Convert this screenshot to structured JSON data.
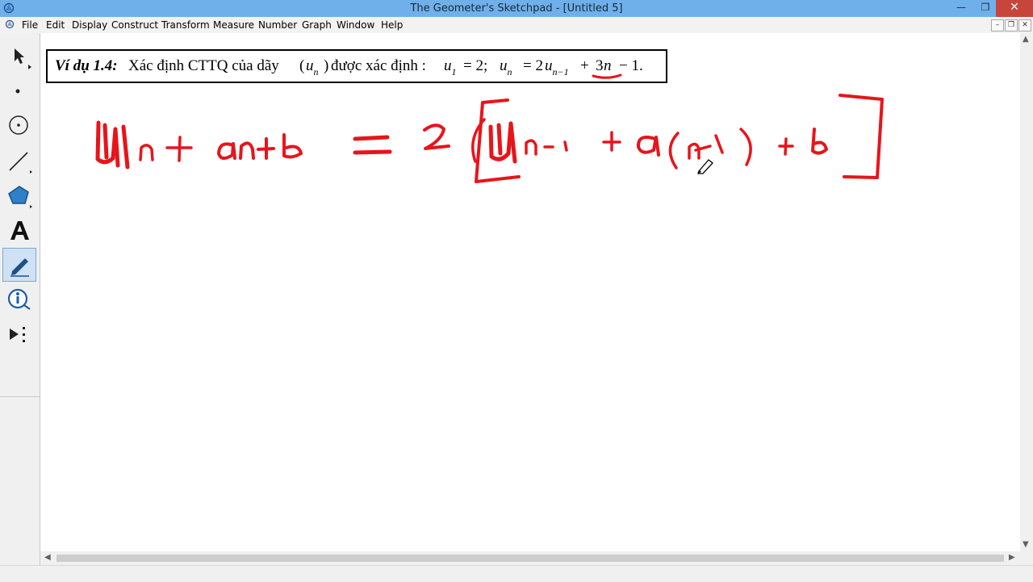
{
  "window": {
    "title": "The Geometer's Sketchpad - [Untitled 5]",
    "minimize_label": "—",
    "restore_label": "❐",
    "close_label": "✕"
  },
  "menu": {
    "items": [
      {
        "label": "File"
      },
      {
        "label": "Edit"
      },
      {
        "label": "Display"
      },
      {
        "label": "Construct"
      },
      {
        "label": "Transform"
      },
      {
        "label": "Measure"
      },
      {
        "label": "Number"
      },
      {
        "label": "Graph"
      },
      {
        "label": "Window"
      },
      {
        "label": "Help"
      }
    ],
    "mdi": {
      "minimize": "–",
      "restore": "❐",
      "close": "✕"
    }
  },
  "toolbox": {
    "tools": [
      {
        "name": "arrow-select-tool",
        "icon": "arrow-icon"
      },
      {
        "name": "point-tool",
        "icon": "point-icon"
      },
      {
        "name": "compass-tool",
        "icon": "circle-icon"
      },
      {
        "name": "straightedge-tool",
        "icon": "segment-icon"
      },
      {
        "name": "polygon-tool",
        "icon": "polygon-icon"
      },
      {
        "name": "text-tool",
        "icon": "text-a-icon",
        "glyph": "A"
      },
      {
        "name": "marker-tool",
        "icon": "pen-icon",
        "active": true
      },
      {
        "name": "information-tool",
        "icon": "info-icon",
        "glyph": "i"
      },
      {
        "name": "custom-tool",
        "icon": "custom-tool-icon"
      }
    ]
  },
  "document": {
    "example": {
      "label": "Ví dụ 1.4:",
      "text": "Xác định CTTQ của dãy",
      "seq_open": "(",
      "seq_var": "u",
      "seq_sub": "n",
      "seq_close": ")",
      "text2": "được xác định :",
      "u1_var": "u",
      "u1_sub": "1",
      "u1_rest": "= 2;",
      "un_var": "u",
      "un_sub": "n",
      "un_eq": "= 2",
      "un1_var": "u",
      "un1_sub": "n−1",
      "plus": "+",
      "coef": "3",
      "n_var": "n",
      "tail": "− 1."
    }
  },
  "colors": {
    "titlebar": "#6fb0ea",
    "ink": "#e8141b",
    "close_button": "#c7453b"
  }
}
